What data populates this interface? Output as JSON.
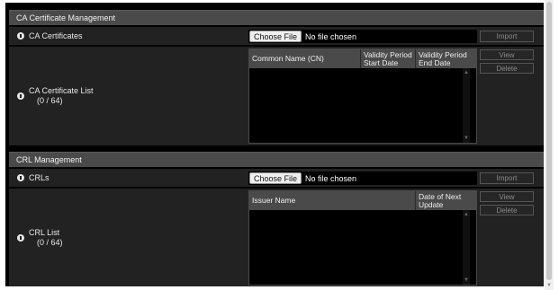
{
  "ca": {
    "header": "CA Certificate Management",
    "certificates_label": "CA Certificates",
    "choose_file": "Choose File",
    "file_status": "No file chosen",
    "import": "Import",
    "list_label": "CA Certificate List",
    "list_count": "(0 / 64)",
    "columns": [
      "Common Name (CN)",
      "Validity Period Start Date",
      "Validity Period End Date"
    ],
    "view": "View",
    "delete": "Delete"
  },
  "crl": {
    "header": "CRL Management",
    "crls_label": "CRLs",
    "choose_file": "Choose File",
    "file_status": "No file chosen",
    "import": "Import",
    "list_label": "CRL List",
    "list_count": "(0 / 64)",
    "columns": [
      "Issuer Name",
      "Date of Next Update"
    ],
    "view": "View",
    "delete": "Delete"
  },
  "icons": {
    "info": "info-icon",
    "scroll_up": "chevron-up-icon",
    "scroll_down": "chevron-down-icon"
  },
  "colors": {
    "header_bg": "#4a4a4a",
    "row_bg": "#222222",
    "panel_bg": "#000000",
    "disabled_text": "#8a8a8a"
  }
}
